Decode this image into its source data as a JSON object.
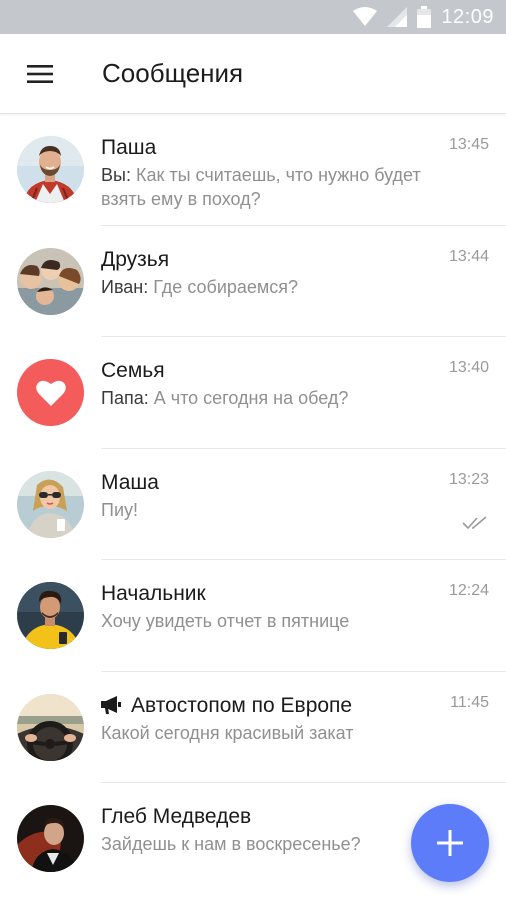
{
  "status_bar": {
    "time": "12:09",
    "icons": [
      "wifi-icon",
      "signal-icon",
      "battery-icon"
    ],
    "background": "#c4c7cc"
  },
  "app_bar": {
    "title": "Сообщения",
    "menu_icon": "hamburger-menu-icon"
  },
  "colors": {
    "accent": "#5c7cfa",
    "heart_avatar": "#f45b5b",
    "secondary_text": "#909090"
  },
  "chats": [
    {
      "name": "Паша",
      "sender": "Вы:",
      "message": "Как ты считаешь, что нужно будет взять ему в поход?",
      "time": "13:45",
      "avatar": "photo-man-beard"
    },
    {
      "name": "Друзья",
      "sender": "Иван:",
      "message": "Где собираемся?",
      "time": "13:44",
      "avatar": "photo-group-friends"
    },
    {
      "name": "Семья",
      "sender": "Папа:",
      "message": "А что сегодня на обед?",
      "time": "13:40",
      "avatar": "heart-icon"
    },
    {
      "name": "Маша",
      "sender": "",
      "message": "Пиу!",
      "time": "13:23",
      "avatar": "photo-woman-sunglasses",
      "status_icon": "double-check-icon"
    },
    {
      "name": "Начальник",
      "sender": "",
      "message": "Хочу увидеть отчет в пятнице",
      "time": "12:24",
      "avatar": "photo-man-yellow"
    },
    {
      "name": "Автостопом по Европе",
      "sender": "",
      "message": "Какой сегодня красивый закат",
      "time": "11:45",
      "avatar": "photo-steering-wheel",
      "name_icon": "megaphone-icon"
    },
    {
      "name": "Глеб Медведев",
      "sender": "",
      "message": "Зайдешь к нам в воскресенье?",
      "time": "",
      "avatar": "photo-man-dark"
    }
  ],
  "fab": {
    "icon": "plus-icon"
  }
}
